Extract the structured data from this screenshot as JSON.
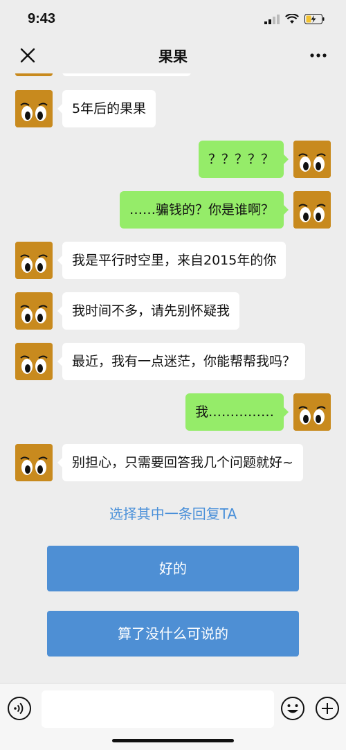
{
  "status": {
    "time": "9:43"
  },
  "header": {
    "title": "果果"
  },
  "messages": [
    {
      "side": "left",
      "text": ""
    },
    {
      "side": "left",
      "text": "5年后的果果"
    },
    {
      "side": "right",
      "text": "？？？？？"
    },
    {
      "side": "right",
      "text": "……骗钱的？你是谁啊？"
    },
    {
      "side": "left",
      "text": "我是平行时空里，来自2015年的你"
    },
    {
      "side": "left",
      "text": "我时间不多，请先别怀疑我"
    },
    {
      "side": "left",
      "text": "最近，我有一点迷茫，你能帮帮我吗？"
    },
    {
      "side": "right",
      "text": "我……………"
    },
    {
      "side": "left",
      "text": "别担心，只需要回答我几个问题就好~"
    }
  ],
  "reply": {
    "prompt": "选择其中一条回复TA",
    "options": [
      "好的",
      "算了没什么可说的"
    ]
  },
  "colors": {
    "background": "#ededed",
    "bubble_sent": "#95ec69",
    "bubble_received": "#ffffff",
    "option_button": "#4e8fd4",
    "prompt_text": "#4a90d9",
    "avatar": "#c88a1e"
  }
}
